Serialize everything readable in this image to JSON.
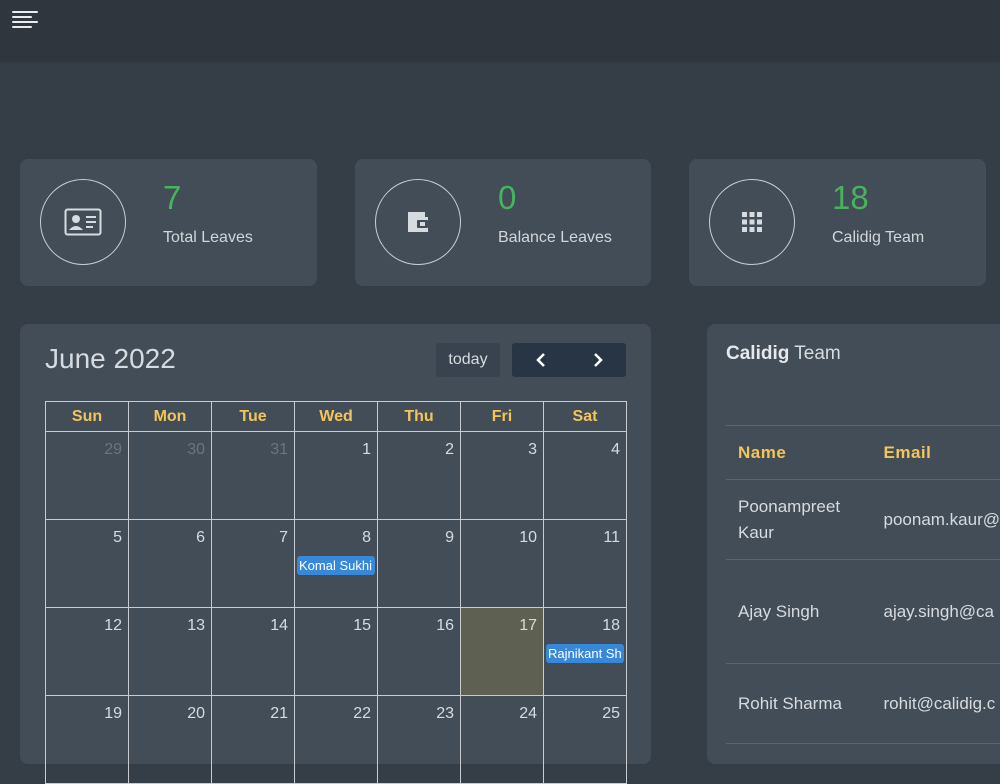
{
  "stats": [
    {
      "value": "7",
      "label": "Total Leaves",
      "icon": "id-card-icon"
    },
    {
      "value": "0",
      "label": "Balance Leaves",
      "icon": "wallet-icon"
    },
    {
      "value": "18",
      "label": "Calidig Team",
      "icon": "grid-icon"
    }
  ],
  "calendar": {
    "title": "June 2022",
    "today_label": "today",
    "weekdays": [
      "Sun",
      "Mon",
      "Tue",
      "Wed",
      "Thu",
      "Fri",
      "Sat"
    ],
    "weeks": [
      [
        "29",
        "30",
        "31",
        "1",
        "2",
        "3",
        "4"
      ],
      [
        "5",
        "6",
        "7",
        "8",
        "9",
        "10",
        "11"
      ],
      [
        "12",
        "13",
        "14",
        "15",
        "16",
        "17",
        "18"
      ],
      [
        "19",
        "20",
        "21",
        "22",
        "23",
        "24",
        "25"
      ]
    ],
    "events": {
      "week2_wed": "Komal Sukhi",
      "week3_sat": "Rajnikant Sh"
    }
  },
  "team": {
    "title_bold": "Calidig",
    "title_rest": " Team",
    "headers": {
      "name": "Name",
      "email": "Email"
    },
    "rows": [
      {
        "name_line1": "Poonampreet",
        "name_line2": "Kaur",
        "email": "poonam.kaur@"
      },
      {
        "name": "Ajay Singh",
        "email": "ajay.singh@ca"
      },
      {
        "name": "Rohit Sharma",
        "email": "rohit@calidig.c"
      }
    ]
  },
  "colors": {
    "accent_green": "#46b45c",
    "header_yellow": "#f2c55a",
    "event_blue": "#3788d8"
  }
}
